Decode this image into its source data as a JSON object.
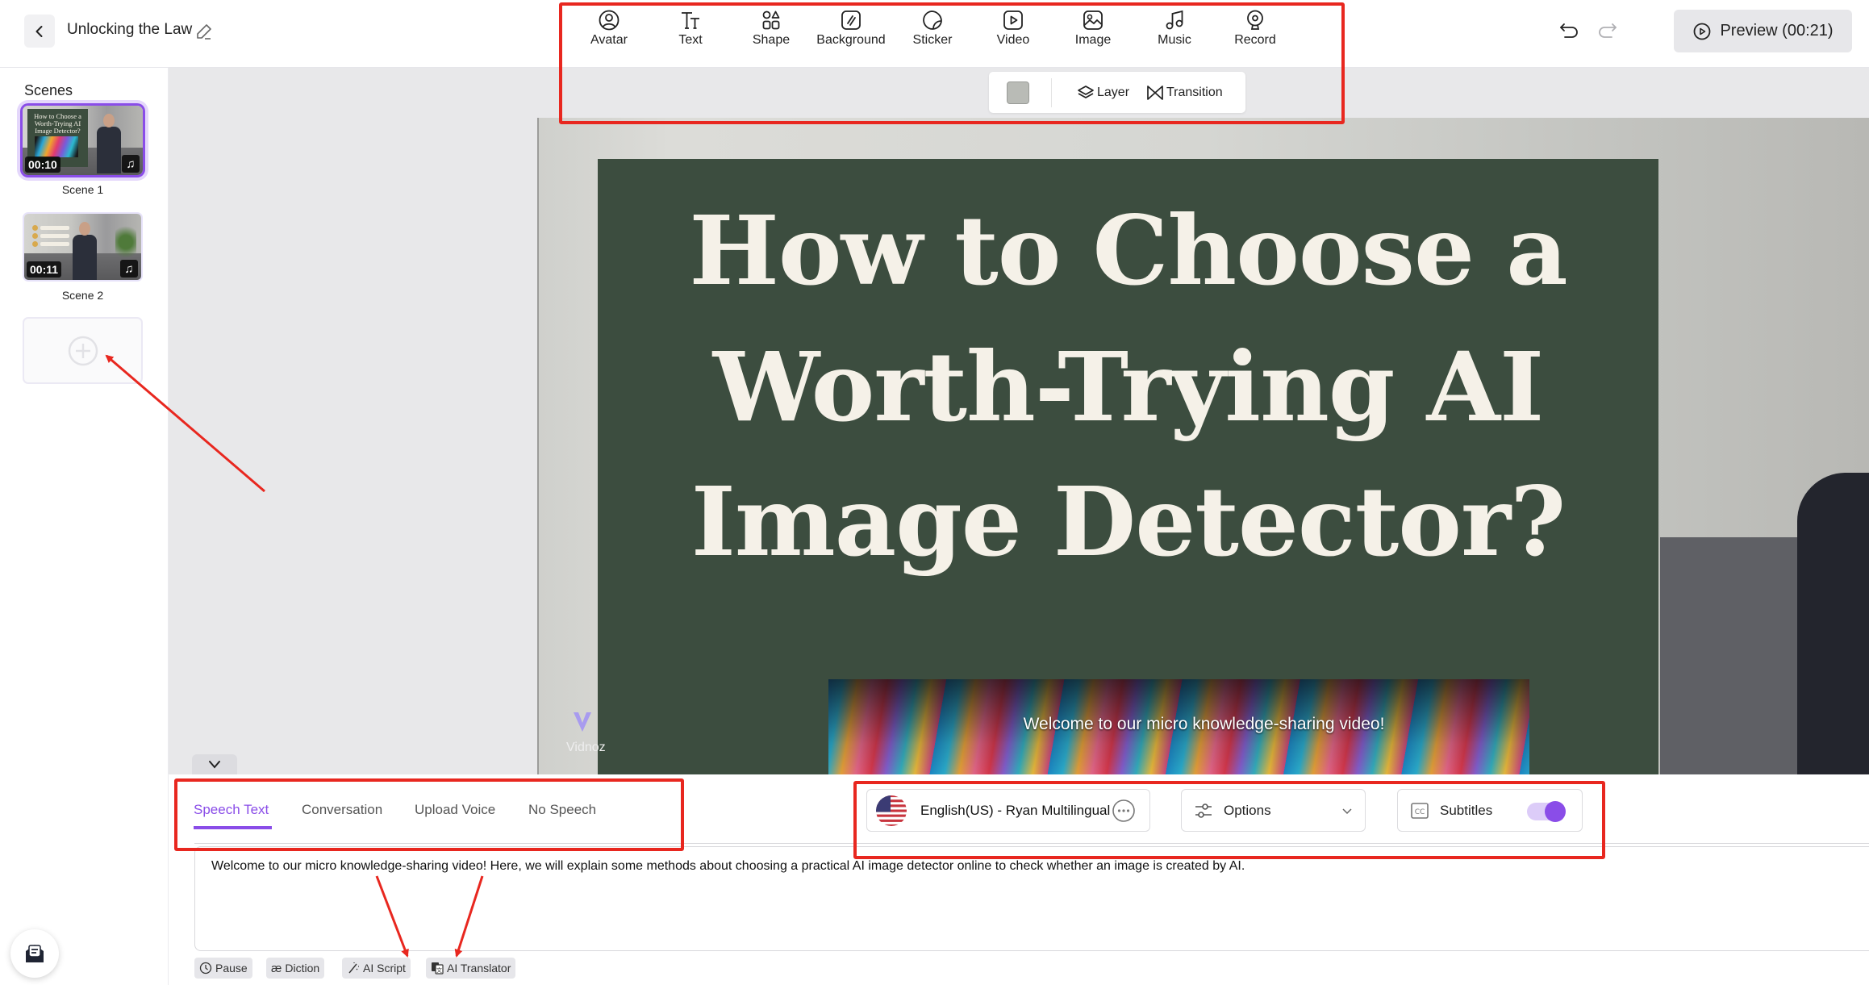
{
  "header": {
    "project_title": "Unlocking the Law",
    "back_icon": "chevron-left-icon",
    "edit_icon": "pencil-icon",
    "undo_icon": "undo-icon",
    "redo_icon": "redo-icon",
    "preview_label": "Preview (00:21)"
  },
  "toolbar": {
    "items": [
      {
        "label": "Avatar",
        "icon": "avatar-icon"
      },
      {
        "label": "Text",
        "icon": "text-icon"
      },
      {
        "label": "Shape",
        "icon": "shape-icon"
      },
      {
        "label": "Background",
        "icon": "background-icon"
      },
      {
        "label": "Sticker",
        "icon": "sticker-icon"
      },
      {
        "label": "Video",
        "icon": "video-icon"
      },
      {
        "label": "Image",
        "icon": "image-icon"
      },
      {
        "label": "Music",
        "icon": "music-icon"
      },
      {
        "label": "Record",
        "icon": "record-icon"
      }
    ],
    "sub": {
      "color_value": "#b9bbb6",
      "layer_label": "Layer",
      "transition_label": "Transition"
    }
  },
  "sidebar": {
    "title": "Scenes",
    "scenes": [
      {
        "label": "Scene 1",
        "duration": "00:10",
        "active": true,
        "thumb_text": "How to Choose a Worth-Trying AI Image Detector?"
      },
      {
        "label": "Scene 2",
        "duration": "00:11",
        "active": false
      }
    ],
    "add_scene_icon": "plus-circle-icon"
  },
  "canvas": {
    "title_lines": [
      "How to Choose a",
      "Worth-Trying AI",
      "Image Detector?"
    ],
    "subtitle": "Welcome to our micro knowledge-sharing video!",
    "watermark": "Vidnoz"
  },
  "speech": {
    "tabs": [
      {
        "label": "Speech Text",
        "active": true
      },
      {
        "label": "Conversation",
        "active": false
      },
      {
        "label": "Upload Voice",
        "active": false
      },
      {
        "label": "No Speech",
        "active": false
      }
    ],
    "voice_label": "English(US) - Ryan Multilingual",
    "options_label": "Options",
    "subtitles_label": "Subtitles",
    "subtitles_enabled": true,
    "text": "Welcome to our micro knowledge-sharing video! Here, we will explain some methods about choosing a practical AI image detector online to check whether an image is created by AI.",
    "tools": [
      {
        "label": "Pause",
        "icon": "clock-icon"
      },
      {
        "label": "Diction",
        "icon": "diction-icon"
      },
      {
        "label": "AI Script",
        "icon": "magic-wand-icon"
      },
      {
        "label": "AI Translator",
        "icon": "translate-icon"
      }
    ]
  },
  "colors": {
    "accent": "#8a4de8",
    "annotation_red": "#e8271f",
    "panel_green": "#3c4d3f"
  }
}
